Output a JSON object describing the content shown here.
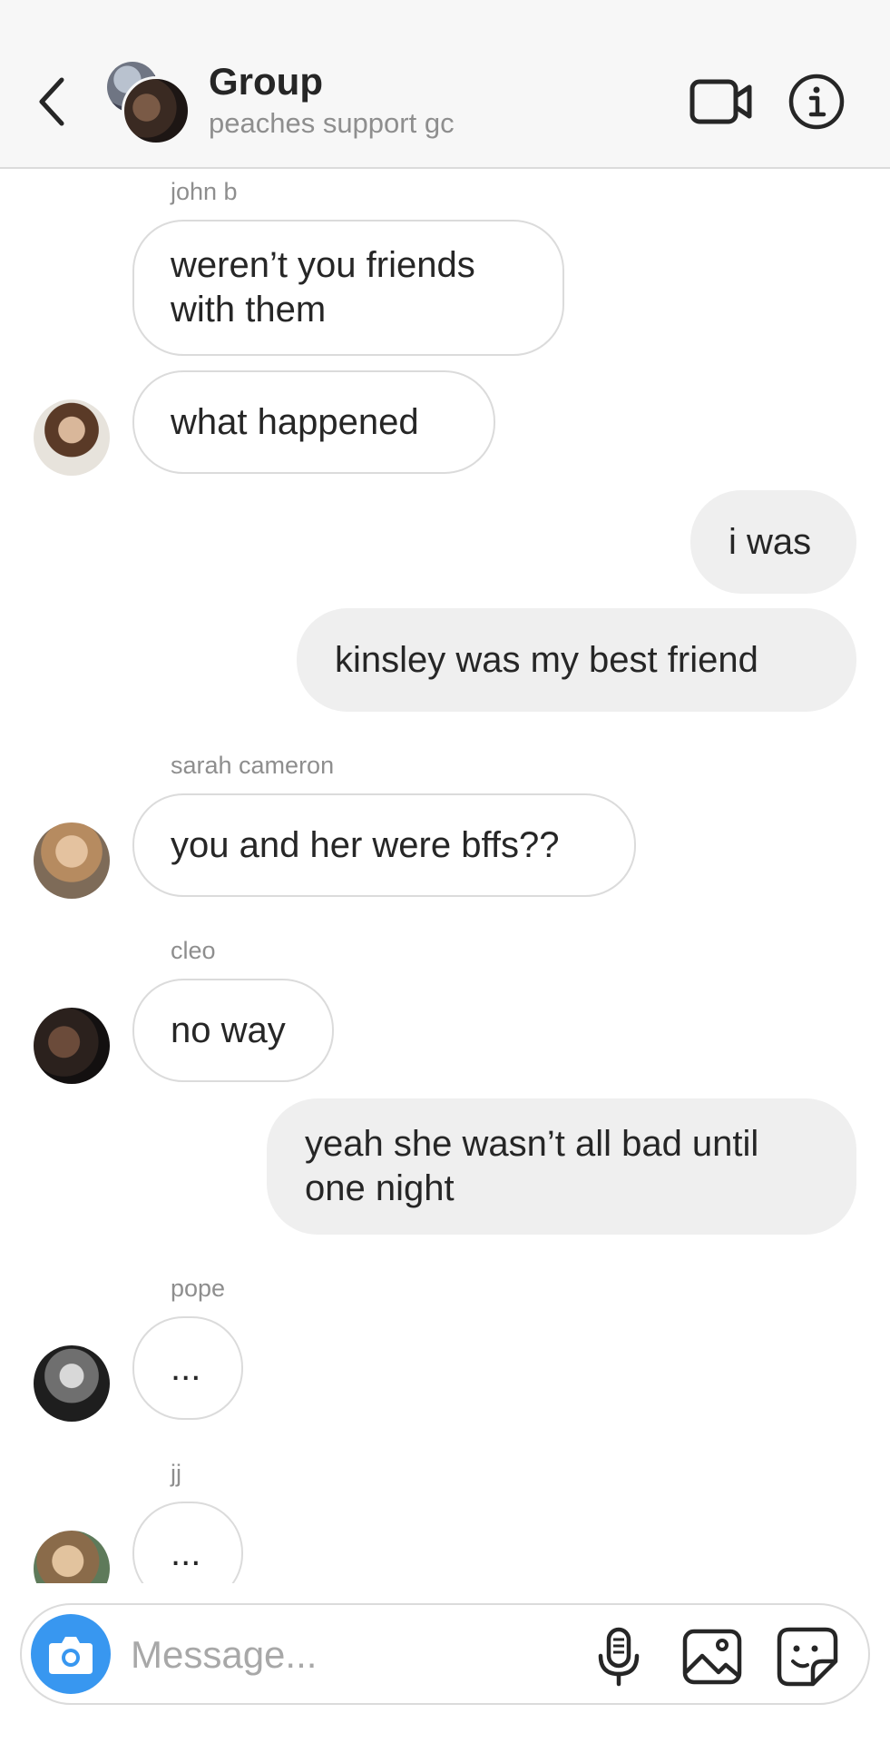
{
  "header": {
    "title": "Group",
    "subtitle": "peaches support gc"
  },
  "messages": {
    "johnb_name": "john b",
    "johnb_1": "weren’t you friends with them",
    "johnb_2": "what happened",
    "me_1": "i was",
    "me_2": "kinsley was my best friend",
    "sarah_name": "sarah cameron",
    "sarah_1": "you and her were bffs??",
    "cleo_name": "cleo",
    "cleo_1": "no way",
    "me_3": "yeah she wasn’t all bad until one night",
    "pope_name": "pope",
    "pope_1": "...",
    "jj_name": "jj",
    "jj_1": "..."
  },
  "composer": {
    "placeholder": "Message..."
  },
  "icons": {
    "back": "chevron-left-icon",
    "video": "video-call-icon",
    "info": "info-icon",
    "camera": "camera-icon",
    "mic": "microphone-icon",
    "gallery": "gallery-icon",
    "sticker": "sticker-icon"
  },
  "colors": {
    "accent": "#3897f0",
    "incoming_bubble_border": "#dbdbdb",
    "outgoing_bubble": "#efefef"
  }
}
